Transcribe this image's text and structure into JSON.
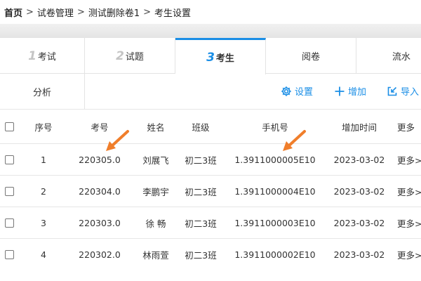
{
  "breadcrumb": {
    "home": "首页",
    "separator": ">",
    "items": [
      "试卷管理",
      "测试删除卷1",
      "考生设置"
    ]
  },
  "tabs": [
    {
      "num": "1",
      "label": "考试"
    },
    {
      "num": "2",
      "label": "试题"
    },
    {
      "num": "3",
      "label": "考生",
      "active": true
    },
    {
      "num": "",
      "label": "阅卷"
    },
    {
      "num": "",
      "label": "流水"
    }
  ],
  "tab_analysis": "分析",
  "actions": {
    "settings": "设置",
    "add": "增加",
    "import": "导入"
  },
  "table": {
    "headers": {
      "index": "序号",
      "exam_no": "考号",
      "name": "姓名",
      "class": "班级",
      "phone": "手机号",
      "added_time": "增加时间",
      "more": "更多"
    },
    "rows": [
      {
        "index": "1",
        "exam_no": "220305.0",
        "name": "刘展飞",
        "class": "初二3班",
        "phone": "1.3911000005E10",
        "added_time": "2023-03-02",
        "more": "更多>"
      },
      {
        "index": "2",
        "exam_no": "220304.0",
        "name": "李鹏宇",
        "class": "初二3班",
        "phone": "1.3911000004E10",
        "added_time": "2023-03-02",
        "more": "更多>"
      },
      {
        "index": "3",
        "exam_no": "220303.0",
        "name": "徐 畅",
        "class": "初二3班",
        "phone": "1.3911000003E10",
        "added_time": "2023-03-02",
        "more": "更多>"
      },
      {
        "index": "4",
        "exam_no": "220302.0",
        "name": "林雨萱",
        "class": "初二3班",
        "phone": "1.3911000002E10",
        "added_time": "2023-03-02",
        "more": "更多>"
      }
    ]
  },
  "icons": {
    "settings": "gear-icon",
    "add": "plus-icon",
    "import": "import-icon",
    "annotation": "arrow-annotation-icon"
  },
  "colors": {
    "accent": "#1a8ee6",
    "annotation": "#f07e2b",
    "inactive_tab_number": "#c4c4c4"
  }
}
